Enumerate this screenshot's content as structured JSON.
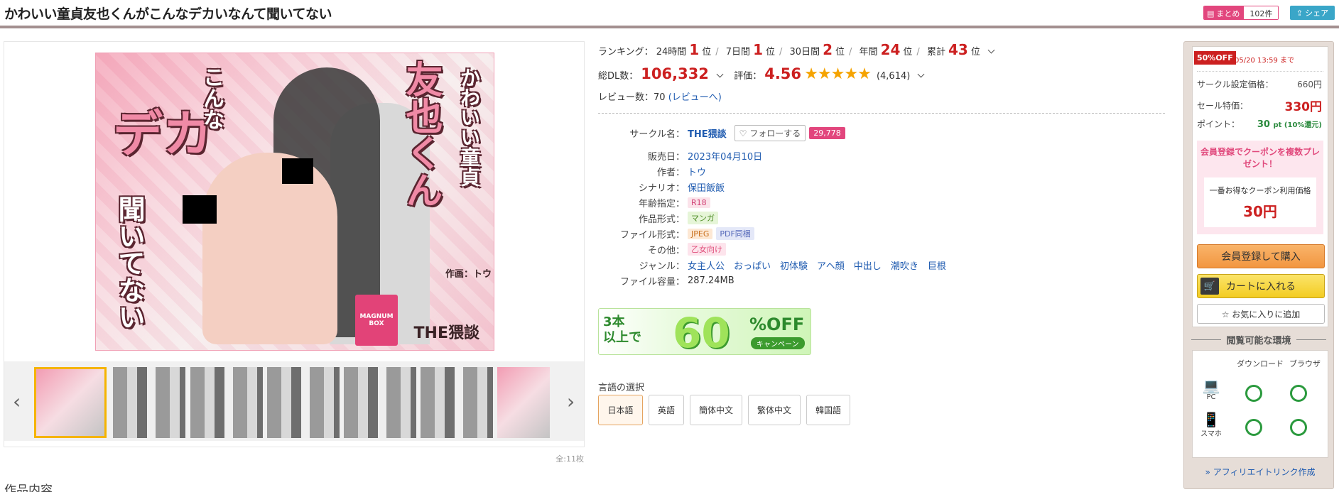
{
  "title": "かわいい童貞友也くんがこんなデカいなんて聞いてない",
  "header": {
    "matome_label": "まとめ",
    "matome_count": "102件",
    "share_label": "シェア"
  },
  "gallery": {
    "cover_texts": {
      "kawaii": "かわいい童貞",
      "tomoya": "友也くん",
      "konna": "こんな",
      "deka": "デカ",
      "kiite": "聞いてない",
      "author_credit": "作画：トウ",
      "circle_logo": "THE猥談",
      "box_label": "MAGNUM BOX"
    },
    "thumbnail_count": 7,
    "image_count_label": "全:11枚"
  },
  "section_heading": "作品内容",
  "ranking": {
    "label": "ランキング：",
    "items": [
      {
        "period": "24時間",
        "rank": "1",
        "unit": "位"
      },
      {
        "period": "7日間",
        "rank": "1",
        "unit": "位"
      },
      {
        "period": "30日間",
        "rank": "2",
        "unit": "位"
      },
      {
        "period": "年間",
        "rank": "24",
        "unit": "位"
      },
      {
        "period": "累計",
        "rank": "43",
        "unit": "位"
      }
    ]
  },
  "downloads": {
    "label": "総DL数：",
    "value": "106,332",
    "rating_label": "評価：",
    "rating_value": "4.56",
    "rating_stars": "★★★★★",
    "rating_count": "(4,614)"
  },
  "reviews": {
    "label": "レビュー数：",
    "count": "70",
    "link_text": "(レビューへ)"
  },
  "specs": {
    "circle_label": "サークル名：",
    "circle_name": "THE猥談",
    "follow_label": "♡ フォローする",
    "follow_count": "29,778",
    "release_label": "販売日：",
    "release_date": "2023年04月10日",
    "author_label": "作者：",
    "author": "トウ",
    "scenario_label": "シナリオ：",
    "scenario": "保田飯飯",
    "age_label": "年齢指定：",
    "age": "R18",
    "format_label": "作品形式：",
    "format": "マンガ",
    "file_format_label": "ファイル形式：",
    "file_format_1": "JPEG",
    "file_format_2": "PDF同梱",
    "other_label": "その他：",
    "other": "乙女向け",
    "genre_label": "ジャンル：",
    "genres": [
      "女主人公",
      "おっぱい",
      "初体験",
      "アヘ顔",
      "中出し",
      "潮吹き",
      "巨根"
    ],
    "size_label": "ファイル容量：",
    "size": "287.24MB"
  },
  "campaign": {
    "left_text_1": "3本",
    "left_text_2": "以上で",
    "big_number": "60",
    "off_text": "%OFF",
    "campaign_text": "キャンペーン"
  },
  "language": {
    "label": "言語の選択",
    "options": [
      "日本語",
      "英語",
      "簡体中文",
      "繁体中文",
      "韓国語"
    ],
    "selected": "日本語"
  },
  "purchase": {
    "off_badge": "50%OFF",
    "off_until": "05/20 13:59 まで",
    "list_price_label": "サークル設定価格：",
    "list_price": "660円",
    "sale_price_label": "セール特価：",
    "sale_price": "330円",
    "point_label": "ポイント：",
    "point_value": "30",
    "point_unit": "pt (10%還元)",
    "coupon_title": "会員登録でクーポンを複数プレゼント！",
    "coupon_caption": "一番お得なクーポン利用価格",
    "coupon_price": "30円",
    "member_buy_label": "会員登録して購入",
    "cart_label": "カートに入れる",
    "favorite_label": "☆ お気に入りに追加"
  },
  "environment": {
    "heading": "閲覧可能な環境",
    "col_download": "ダウンロード",
    "col_browser": "ブラウザ",
    "pc_label": "PC",
    "phone_label": "スマホ"
  },
  "affiliate_label": "» アフィリエイトリンク作成",
  "colors": {
    "accent_red": "#cc2020",
    "pink": "#e2467d",
    "link_blue": "#1f5bb0",
    "ok_green": "#2b9a3e"
  }
}
